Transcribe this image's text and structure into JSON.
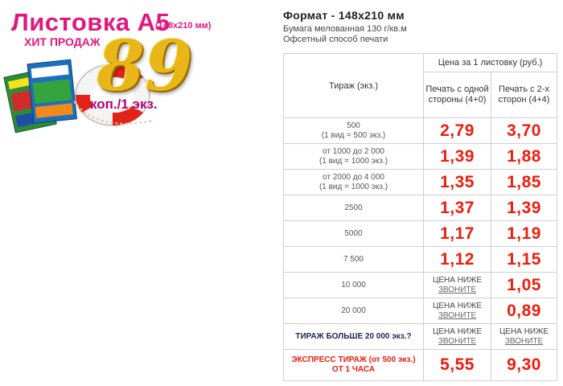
{
  "promo": {
    "title": "Листовка А5",
    "size_note": "(148x210 мм)",
    "hit_label": "ХИТ ПРОДАЖ",
    "price_big": "89",
    "price_unit": "коп./1 экз.",
    "accent_color": "#e0187e",
    "gold_color": "#e9b619"
  },
  "format": {
    "title": "Формат - 148x210 мм",
    "paper": "Бумага мелованная 130 г/кв.м",
    "print_method": "Офсетный способ печати"
  },
  "table": {
    "header_price": "Цена за 1 листовку (руб.)",
    "header_tirazh": "Тираж (экз.)",
    "header_col_single": "Печать с одной стороны (4+0)",
    "header_col_double": "Печать с 2-х сторон (4+4)",
    "price_color": "#ee1c0e",
    "rows": [
      {
        "qty_line1": "500",
        "qty_line2": "(1 вид = 500 экз.)",
        "single": "2,79",
        "double": "3,70"
      },
      {
        "qty_line1": "от 1000 до 2 000",
        "qty_line2": "(1 вид = 1000 экз.)",
        "single": "1,39",
        "double": "1,88"
      },
      {
        "qty_line1": "от 2000 до 4 000",
        "qty_line2": "(1 вид = 1000 экз.)",
        "single": "1,35",
        "double": "1,85"
      },
      {
        "qty_line1": "2500",
        "single": "1,37",
        "double": "1,39"
      },
      {
        "qty_line1": "5000",
        "single": "1,17",
        "double": "1,19"
      },
      {
        "qty_line1": "7 500",
        "single": "1,12",
        "double": "1,15"
      },
      {
        "qty_line1": "10 000",
        "single_lower": "ЦЕНА НИЖЕ",
        "single_call": "ЗВОНИТЕ",
        "double": "1,05"
      },
      {
        "qty_line1": "20 000",
        "single_lower": "ЦЕНА НИЖЕ",
        "single_call": "ЗВОНИТЕ",
        "double": "0,89"
      },
      {
        "qty_line1": "ТИРАЖ БОЛЬШЕ 20 000 экз.?",
        "single_lower": "ЦЕНА НИЖЕ",
        "single_call": "ЗВОНИТЕ",
        "double_lower": "ЦЕНА НИЖЕ",
        "double_call": "ЗВОНИТЕ"
      },
      {
        "qty_line1": "ЭКСПРЕСС ТИРАЖ (от 500 экз.)",
        "qty_line2": "ОТ 1 ЧАСА",
        "single": "5,55",
        "double": "9,30"
      }
    ]
  }
}
